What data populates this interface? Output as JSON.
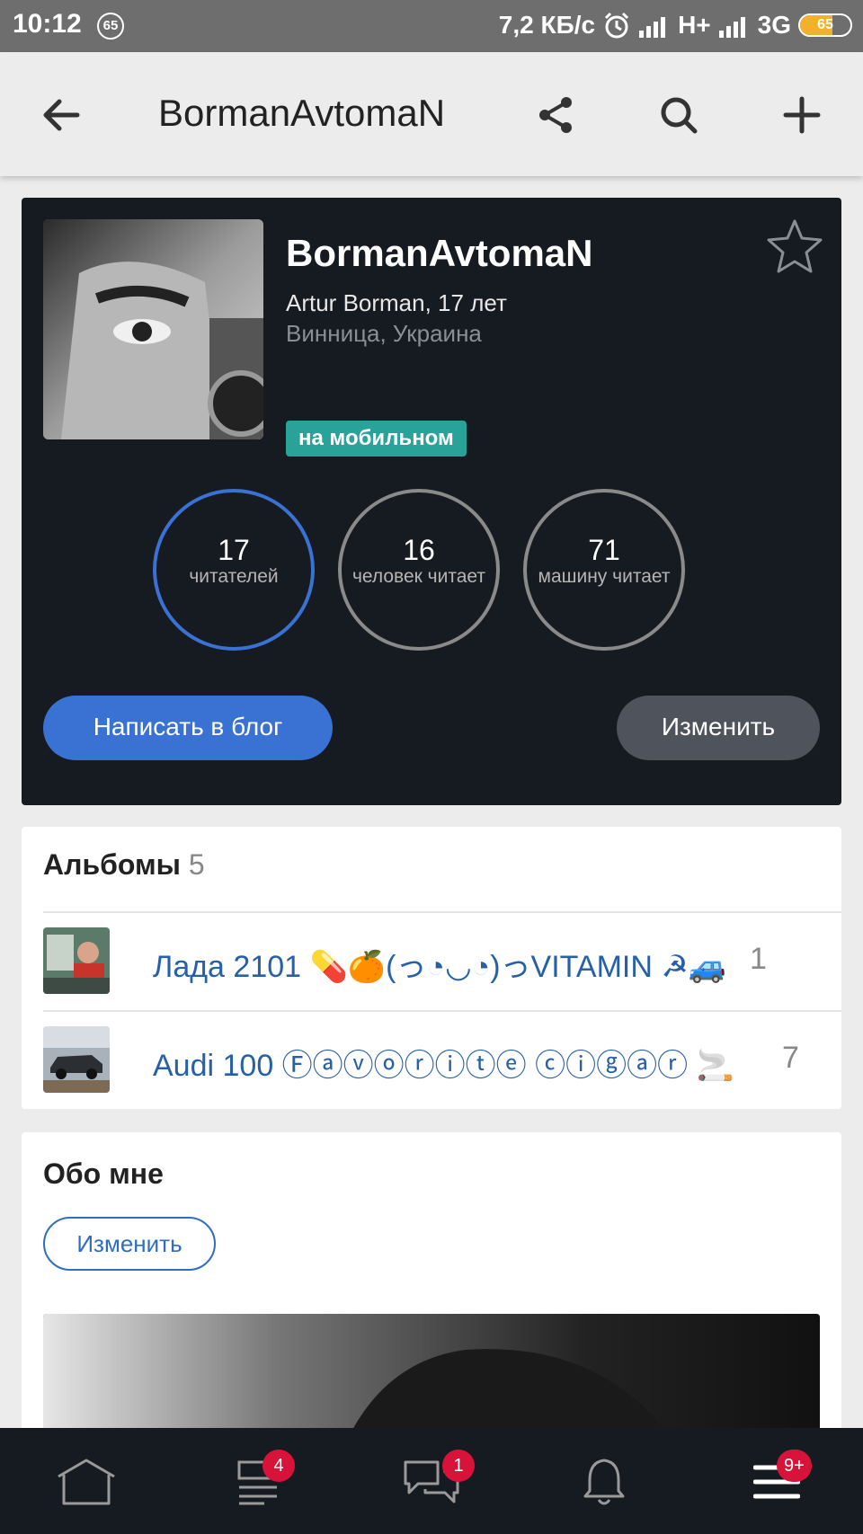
{
  "status_bar": {
    "time": "10:12",
    "notif_badge": "65",
    "net_speed": "7,2 КБ/с",
    "network1": "H+",
    "network2": "3G",
    "battery": "65",
    "battery_level": 0.65,
    "battery_color": "#f2b12b"
  },
  "app_bar": {
    "title": "BormanAvtomaN",
    "icons": [
      "back-arrow-icon",
      "share-icon",
      "search-icon",
      "plus-icon"
    ]
  },
  "profile": {
    "nickname": "BormanAvtomaN",
    "name_age": "Artur Borman, 17 лет",
    "location": "Винница, Украина",
    "mobile_badge": "на мобильном",
    "stats": [
      {
        "number": "17",
        "label": "читателей"
      },
      {
        "number": "16",
        "label": "человек читает"
      },
      {
        "number": "71",
        "label": "машину читает"
      }
    ],
    "write_button": "Написать в блог",
    "edit_button": "Изменить",
    "accent_color": "#3a72d4"
  },
  "albums": {
    "title": "Альбомы",
    "count": "5",
    "items": [
      {
        "name": "Лада 2101 💊🍊(っ◔◡◔)っVITAMIN ☭🚙",
        "count": "1"
      },
      {
        "name": "Audi 100 Ⓕⓐⓥⓞⓡⓘⓣⓔ ⓒⓘⓖⓐⓡ 🚬",
        "count": "7"
      }
    ]
  },
  "about": {
    "title": "Обо мне",
    "edit_button": "Изменить"
  },
  "bottom_nav": {
    "items": [
      {
        "icon": "home-icon",
        "badge": ""
      },
      {
        "icon": "feed-icon",
        "badge": "4"
      },
      {
        "icon": "messages-icon",
        "badge": "1"
      },
      {
        "icon": "bell-icon",
        "badge": ""
      },
      {
        "icon": "menu-icon",
        "badge": "9+"
      }
    ],
    "badge_color": "#d8133a"
  }
}
